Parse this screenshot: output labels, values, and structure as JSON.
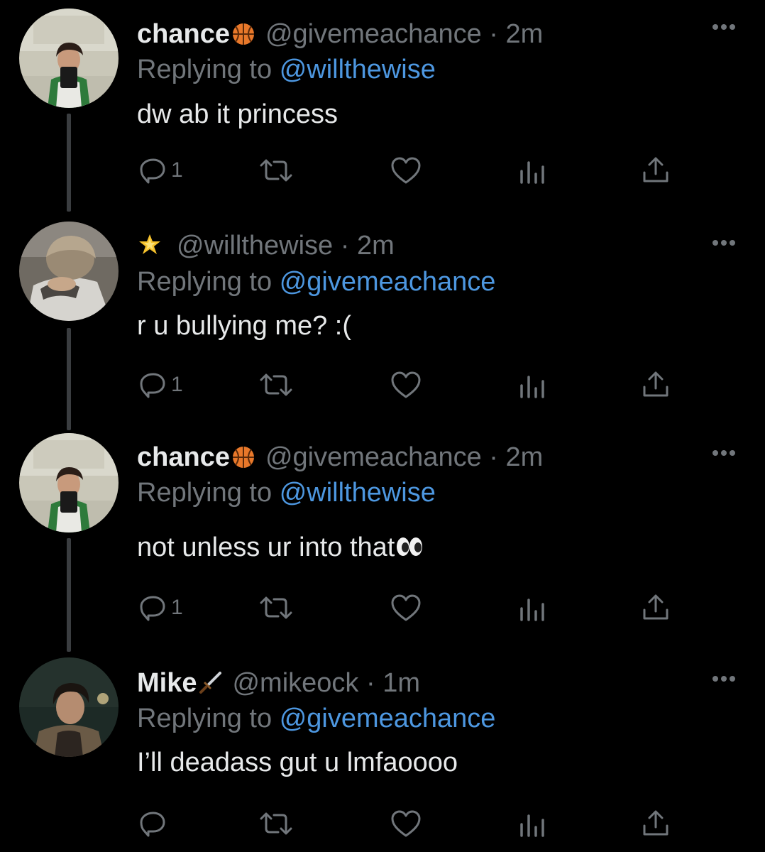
{
  "colors": {
    "background": "#000000",
    "text": "#e7e9ea",
    "muted": "#71767b",
    "link": "#4d97e0",
    "thread_line": "#3a3d40"
  },
  "tweets": [
    {
      "display_name": "chance",
      "name_emoji": "basketball-icon",
      "handle": "@givemeachance",
      "time": "2m",
      "replying_label": "Replying to",
      "replying_to": "@willthewise",
      "text": "dw ab it princess",
      "reply_count": "1"
    },
    {
      "display_name": "",
      "name_emoji": "glowing-star-icon",
      "handle": "@willthewise",
      "time": "2m",
      "replying_label": "Replying to",
      "replying_to": "@givemeachance",
      "text": "r u bullying me? :(",
      "reply_count": "1"
    },
    {
      "display_name": "chance",
      "name_emoji": "basketball-icon",
      "handle": "@givemeachance",
      "time": "2m",
      "replying_label": "Replying to",
      "replying_to": "@willthewise",
      "text": "not unless ur into that",
      "text_emoji": "eyes-icon",
      "reply_count": "1"
    },
    {
      "display_name": "Mike",
      "name_emoji": "dagger-icon",
      "handle": "@mikeock",
      "time": "1m",
      "replying_label": "Replying to",
      "replying_to": "@givemeachance",
      "text": "I’ll deadass gut u lmfaoooo",
      "reply_count": ""
    }
  ],
  "separator": " · "
}
